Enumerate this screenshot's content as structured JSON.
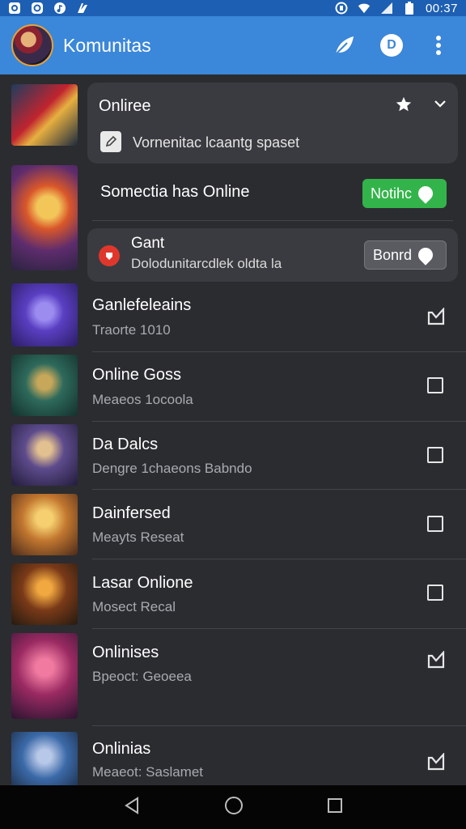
{
  "status_bar": {
    "time": "00:37",
    "left_icons": [
      "camera-icon",
      "shield-icon",
      "music-icon",
      "signal-app-icon"
    ],
    "right_icons": [
      "nfc-icon",
      "wifi-icon",
      "cell-signal-icon",
      "battery-icon"
    ]
  },
  "app_bar": {
    "title": "Komunitas",
    "badge": "D",
    "colors": {
      "background": "#3b87d9",
      "status": "#1d5fb2"
    }
  },
  "online_card": {
    "title": "Onliree",
    "description": "Vornenitac lcaantg spaset"
  },
  "featured": {
    "title": "Somectia has Online",
    "button_label": "Notihc",
    "button_color": "#33b44a"
  },
  "game_card": {
    "title": "Gant",
    "subtitle": "Dolodunitarcdlek oldta la",
    "button_label": "Bonrd",
    "icon_color": "#e0372c"
  },
  "list": [
    {
      "title": "Ganlefeleains",
      "subtitle": "Traorte 1010",
      "checked": true
    },
    {
      "title": "Online Goss",
      "subtitle": "Meaeos 1ocoola",
      "checked": false
    },
    {
      "title": "Da Dalcs",
      "subtitle": "Dengre 1chaeons Babndo",
      "checked": false
    },
    {
      "title": "Dainfersed",
      "subtitle": "Meayts Reseat",
      "checked": false
    },
    {
      "title": "Lasar Onlione",
      "subtitle": "Mosect Recal",
      "checked": false
    },
    {
      "title": "Onlinises",
      "subtitle": "Bpeoct: Geoeea",
      "checked": true
    },
    {
      "title": "Onlinias",
      "subtitle": "Meaeot: Saslamet",
      "checked": true
    }
  ]
}
